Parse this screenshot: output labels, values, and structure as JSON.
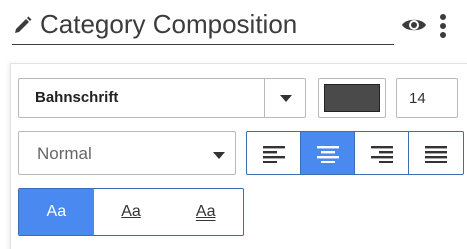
{
  "header": {
    "title": "Category Composition",
    "edit_icon": "pencil-icon",
    "visibility_icon": "eye-icon",
    "menu_icon": "more-vertical-icon"
  },
  "font": {
    "family_label": "Bahnschrift",
    "color": "#4a4a4a",
    "size": "14",
    "weight_label": "Normal"
  },
  "alignment": {
    "options": [
      "left",
      "center",
      "right",
      "justify"
    ],
    "selected": "center"
  },
  "text_case": {
    "options": [
      {
        "label": "Aa",
        "style": "normal"
      },
      {
        "label": "Aa",
        "style": "underline"
      },
      {
        "label": "Aa",
        "style": "double-underline"
      }
    ],
    "selected": 0
  },
  "colors": {
    "accent": "#4a8af0",
    "border_active": "#3a6fb6",
    "border": "#b9b9b9"
  }
}
